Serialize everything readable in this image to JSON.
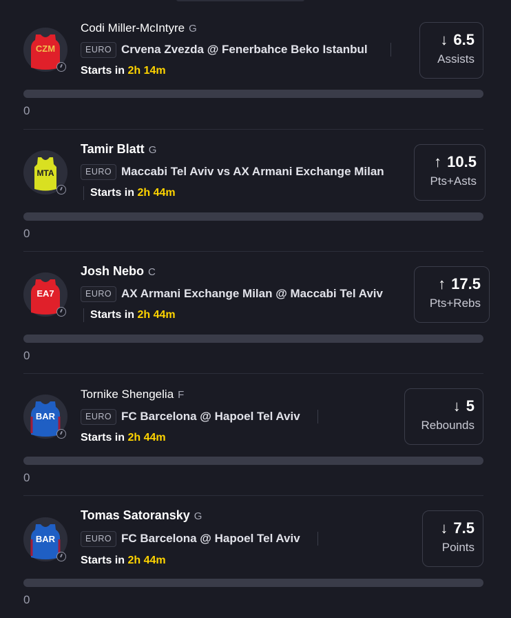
{
  "picks": [
    {
      "player": "Codi Miller-McIntyre",
      "position": "G",
      "team_abbr": "CZM",
      "jersey_color": "#e0202a",
      "jersey_text_color": "#f2c14e",
      "league": "EURO",
      "matchup": "Crvena Zvezda @ Fenerbahce Beko Istanbul",
      "starts_label": "Starts in",
      "starts_time": "2h 14m",
      "direction": "down",
      "arrow": "↓",
      "line": "6.5",
      "stat": "Assists",
      "progress": 0,
      "progress_label": "0"
    },
    {
      "player": "Tamir Blatt",
      "position": "G",
      "team_abbr": "MTA",
      "jersey_color": "#d9e021",
      "jersey_text_color": "#1a1b24",
      "league": "EURO",
      "matchup": "Maccabi Tel Aviv vs AX Armani Exchange Milan",
      "starts_label": "Starts in",
      "starts_time": "2h 44m",
      "direction": "up",
      "arrow": "↑",
      "line": "10.5",
      "stat": "Pts+Asts",
      "progress": 0,
      "progress_label": "0"
    },
    {
      "player": "Josh Nebo",
      "position": "C",
      "team_abbr": "EA7",
      "jersey_color": "#e0202a",
      "jersey_text_color": "#ffffff",
      "league": "EURO",
      "matchup": "AX Armani Exchange Milan @ Maccabi Tel Aviv",
      "starts_label": "Starts in",
      "starts_time": "2h 44m",
      "direction": "up",
      "arrow": "↑",
      "line": "17.5",
      "stat": "Pts+Rebs",
      "progress": 0,
      "progress_label": "0"
    },
    {
      "player": "Tornike Shengelia",
      "position": "F",
      "team_abbr": "BAR",
      "jersey_color": "#1f5fc4",
      "jersey_text_color": "#ffffff",
      "league": "EURO",
      "matchup": "FC Barcelona @ Hapoel Tel Aviv",
      "starts_label": "Starts in",
      "starts_time": "2h 44m",
      "direction": "down",
      "arrow": "↓",
      "line": "5",
      "stat": "Rebounds",
      "progress": 0,
      "progress_label": "0"
    },
    {
      "player": "Tomas Satoransky",
      "position": "G",
      "team_abbr": "BAR",
      "jersey_color": "#1f5fc4",
      "jersey_text_color": "#ffffff",
      "league": "EURO",
      "matchup": "FC Barcelona @ Hapoel Tel Aviv",
      "starts_label": "Starts in",
      "starts_time": "2h 44m",
      "direction": "down",
      "arrow": "↓",
      "line": "7.5",
      "stat": "Points",
      "progress": 0,
      "progress_label": "0"
    }
  ],
  "colors": {
    "background": "#1a1b24",
    "accent_time": "#ffd400",
    "track": "#3a3c49"
  }
}
